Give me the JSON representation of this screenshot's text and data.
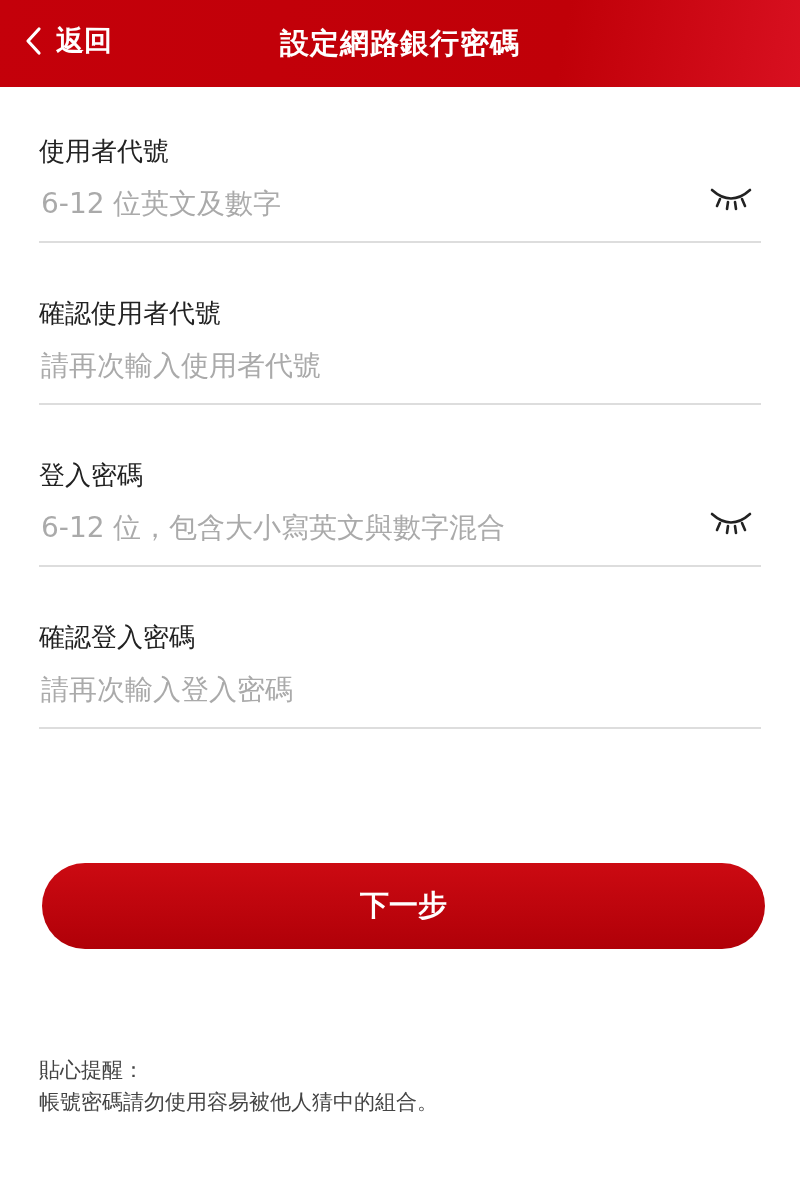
{
  "header": {
    "back": "返回",
    "title": "設定網路銀行密碼"
  },
  "fields": [
    {
      "label": "使用者代號",
      "placeholder": "6-12 位英文及數字",
      "kind": "secret"
    },
    {
      "label": "確認使用者代號",
      "placeholder": "請再次輸入使用者代號",
      "kind": "plain"
    },
    {
      "label": "登入密碼",
      "placeholder": "6-12 位，包含大小寫英文與數字混合",
      "kind": "secret"
    },
    {
      "label": "確認登入密碼",
      "placeholder": "請再次輸入登入密碼",
      "kind": "plain"
    }
  ],
  "button": "下一步",
  "notes": [
    "貼心提醒：",
    "帳號密碼請勿使用容易被他人猜中的組合。"
  ]
}
